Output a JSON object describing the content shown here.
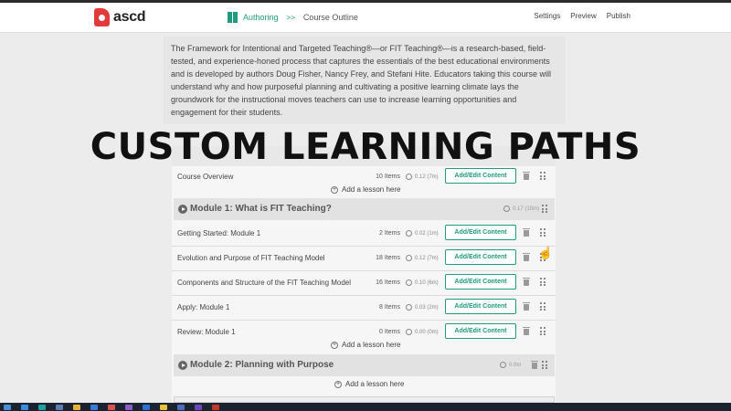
{
  "brand": {
    "logo_text": "ascd",
    "logo_color": "#e03a3a"
  },
  "breadcrumb": {
    "section": "Authoring",
    "separator": ">>",
    "current": "Course Outline",
    "accent": "#1f9b7e"
  },
  "topnav": {
    "settings": "Settings",
    "preview": "Preview",
    "publish": "Publish"
  },
  "intro_text": "The Framework for Intentional and Targeted Teaching®—or FIT Teaching®—is a research-based, field-tested, and experience-honed process that captures the essentials of the best educational environments and is developed by authors Doug Fisher, Nancy Frey, and Stefani Hite. Educators taking this course will understand why and how purposeful planning and cultivating a positive learning climate lays the groundwork for the instructional moves teachers can use to increase learning opportunities and engagement for their students.",
  "headline": "CUSTOM LEARNING PATHS",
  "add_lesson_label": "Add a lesson here",
  "add_edit_label": "Add/Edit Content",
  "overview_lesson": {
    "title": "Course Overview",
    "items": "10 Items",
    "time": "0.12 (7m)"
  },
  "modules": [
    {
      "title": "Module 1: What is FIT Teaching?",
      "time": "0.17 (10m)",
      "lessons": [
        {
          "title": "Getting Started: Module 1",
          "items": "2 Items",
          "time": "0.02 (1m)"
        },
        {
          "title": "Evolution and Purpose of FIT Teaching Model",
          "items": "18 Items",
          "time": "0.12 (7m)"
        },
        {
          "title": "Components and Structure of the FIT Teaching Model",
          "items": "16 Items",
          "time": "0.10 (6m)"
        },
        {
          "title": "Apply: Module 1",
          "items": "8 Items",
          "time": "0.03 (2m)"
        },
        {
          "title": "Review: Module 1",
          "items": "0 Items",
          "time": "0.00 (0m)"
        }
      ]
    },
    {
      "title": "Module 2: Planning with Purpose",
      "time": "0.0m",
      "lessons": []
    }
  ],
  "icons": [
    "play-circle-icon",
    "clock-icon",
    "trash-icon",
    "drag-handle-icon",
    "plus-circle-icon",
    "hand-cursor-icon"
  ]
}
